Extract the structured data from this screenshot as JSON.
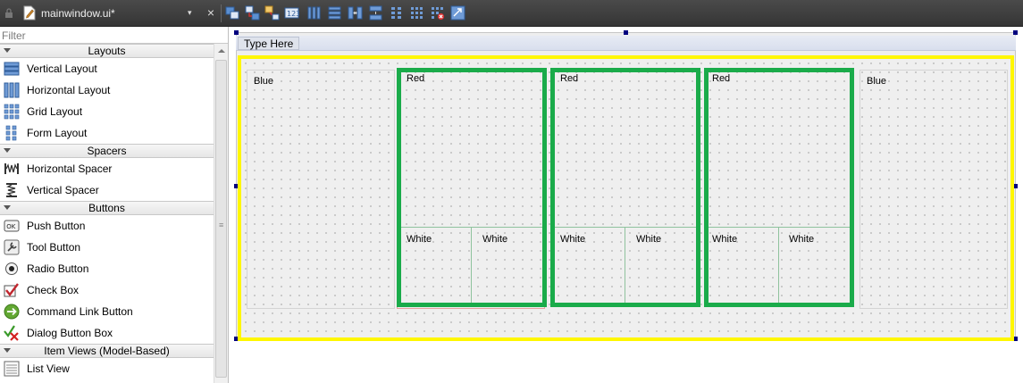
{
  "window": {
    "file_name": "mainwindow.ui*",
    "dropdown_symbol": "▾",
    "close_symbol": "×"
  },
  "toolbar": {
    "tools": [
      {
        "icon": "edit-widgets-icon"
      },
      {
        "icon": "edit-signals-slots-icon"
      },
      {
        "icon": "edit-buddies-icon"
      },
      {
        "icon": "edit-tab-order-icon"
      },
      {
        "icon": "layout-horizontal-icon"
      },
      {
        "icon": "layout-vertical-icon"
      },
      {
        "icon": "layout-horizontal-splitter-icon"
      },
      {
        "icon": "layout-vertical-splitter-icon"
      },
      {
        "icon": "layout-form-icon"
      },
      {
        "icon": "layout-grid-icon"
      },
      {
        "icon": "break-layout-icon"
      },
      {
        "icon": "adjust-size-icon"
      }
    ]
  },
  "widget_box": {
    "filter_placeholder": "Filter",
    "categories": [
      {
        "label": "Layouts",
        "items": [
          {
            "label": "Vertical Layout",
            "icon": "vertical-layout-icon"
          },
          {
            "label": "Horizontal Layout",
            "icon": "horizontal-layout-icon"
          },
          {
            "label": "Grid Layout",
            "icon": "grid-layout-icon"
          },
          {
            "label": "Form Layout",
            "icon": "form-layout-icon"
          }
        ]
      },
      {
        "label": "Spacers",
        "items": [
          {
            "label": "Horizontal Spacer",
            "icon": "horizontal-spacer-icon"
          },
          {
            "label": "Vertical Spacer",
            "icon": "vertical-spacer-icon"
          }
        ]
      },
      {
        "label": "Buttons",
        "items": [
          {
            "label": "Push Button",
            "icon": "push-button-icon"
          },
          {
            "label": "Tool Button",
            "icon": "tool-button-icon"
          },
          {
            "label": "Radio Button",
            "icon": "radio-button-icon"
          },
          {
            "label": "Check Box",
            "icon": "check-box-icon"
          },
          {
            "label": "Command Link Button",
            "icon": "command-link-button-icon"
          },
          {
            "label": "Dialog Button Box",
            "icon": "dialog-button-box-icon"
          }
        ]
      },
      {
        "label": "Item Views (Model-Based)",
        "items": [
          {
            "label": "List View",
            "icon": "list-view-icon"
          }
        ]
      }
    ],
    "push_button_glyph": "OK",
    "scroll_grip": "≡"
  },
  "form": {
    "menu_placeholder": "Type Here",
    "panels": {
      "blue_left": "Blue",
      "red_1": "Red",
      "red_2": "Red",
      "red_3": "Red",
      "blue_right": "Blue",
      "white_1a": "White",
      "white_1b": "White",
      "white_2a": "White",
      "white_2b": "White",
      "white_3a": "White",
      "white_3b": "White"
    },
    "colors": {
      "selection_highlight": "#fff700",
      "group_outline": "#1aab4a",
      "handle": "#00007f"
    }
  }
}
